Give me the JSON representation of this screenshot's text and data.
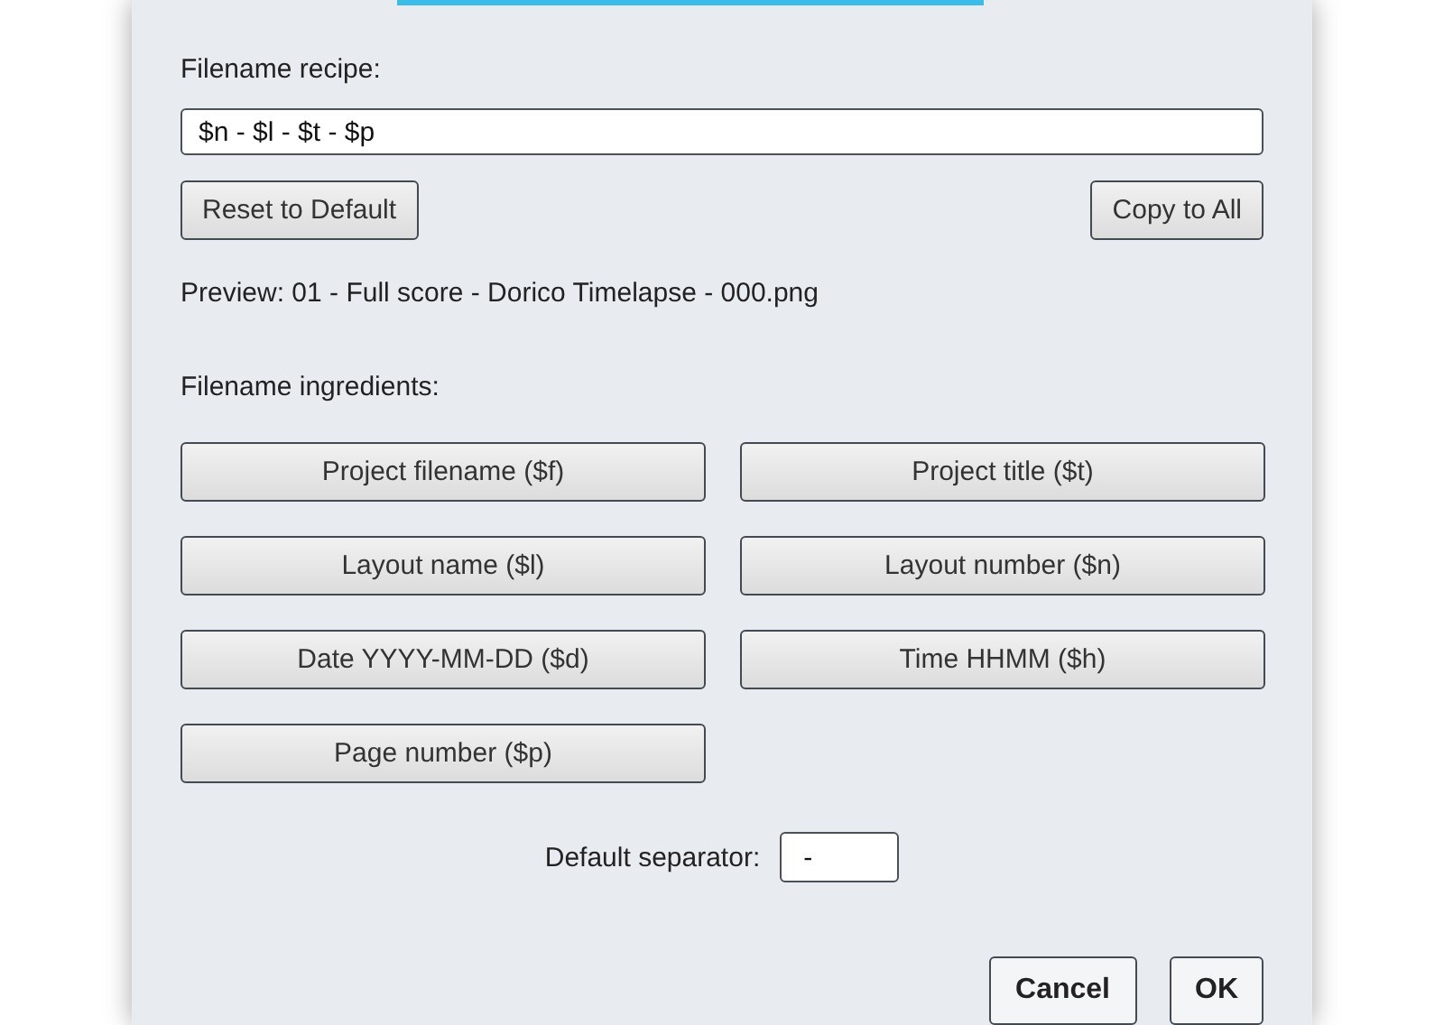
{
  "recipe": {
    "label": "Filename recipe:",
    "value": "$n - $l - $t - $p"
  },
  "recipe_buttons": [
    "Reset to Default",
    "Copy to All"
  ],
  "preview": "Preview: 01 - Full score - Dorico Timelapse - 000.png",
  "ingredients": {
    "label": "Filename ingredients:",
    "buttons": [
      "Project filename ($f)",
      "Project title ($t)",
      "Layout name ($l)",
      "Layout number ($n)",
      "Date YYYY-MM-DD ($d)",
      "Time HHMM ($h)",
      "Page number ($p)"
    ]
  },
  "separator": {
    "label": "Default separator:",
    "value": "-"
  },
  "dialog_buttons": [
    "Cancel",
    "OK"
  ]
}
